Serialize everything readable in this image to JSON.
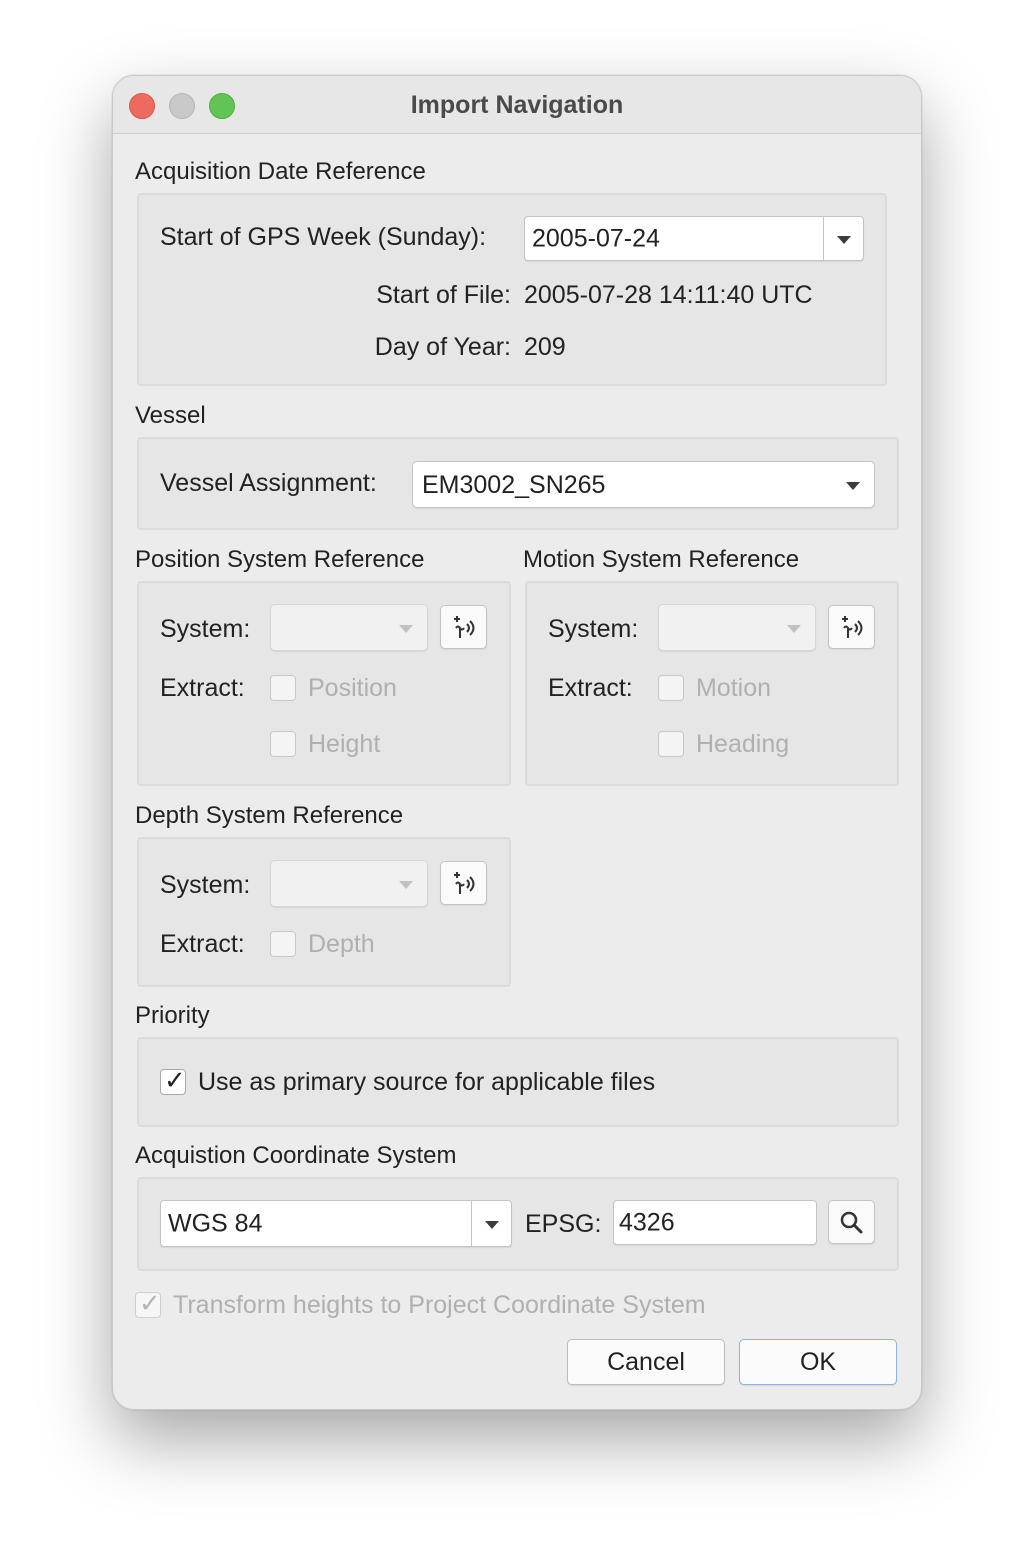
{
  "window": {
    "title": "Import Navigation"
  },
  "acquisition_date": {
    "title": "Acquisition Date Reference",
    "gps_week_label": "Start of GPS Week (Sunday):",
    "gps_week_value": "2005-07-24",
    "start_of_file_label": "Start of File:",
    "start_of_file_value": "2005-07-28 14:11:40 UTC",
    "day_of_year_label": "Day of Year:",
    "day_of_year_value": "209"
  },
  "vessel": {
    "title": "Vessel",
    "assignment_label": "Vessel Assignment:",
    "assignment_value": "EM3002_SN265"
  },
  "position_ref": {
    "title": "Position System Reference",
    "system_label": "System:",
    "extract_label": "Extract:",
    "opt1": "Position",
    "opt2": "Height"
  },
  "motion_ref": {
    "title": "Motion System Reference",
    "system_label": "System:",
    "extract_label": "Extract:",
    "opt1": "Motion",
    "opt2": "Heading"
  },
  "depth_ref": {
    "title": "Depth System Reference",
    "system_label": "System:",
    "extract_label": "Extract:",
    "opt1": "Depth"
  },
  "priority": {
    "title": "Priority",
    "primary_label": "Use as primary source for applicable files",
    "primary_checked": true
  },
  "coord_system": {
    "title": "Acquistion Coordinate System",
    "crs_value": "WGS 84",
    "epsg_label": "EPSG:",
    "epsg_value": "4326"
  },
  "transform_heights": {
    "label": "Transform heights to Project Coordinate System",
    "checked": true
  },
  "buttons": {
    "cancel": "Cancel",
    "ok": "OK"
  },
  "icons": {
    "close": "close-window-icon",
    "minimize": "minimize-window-icon",
    "maximize": "maximize-window-icon",
    "sensor": "sensor-signal-icon",
    "search": "search-icon",
    "dropdown": "chevron-down-icon",
    "check": "checkmark-icon"
  },
  "colors": {
    "close": "#ed6a5e",
    "maximize": "#61c454",
    "window_bg": "#ececec",
    "default_button_border": "#8fb3d9"
  }
}
